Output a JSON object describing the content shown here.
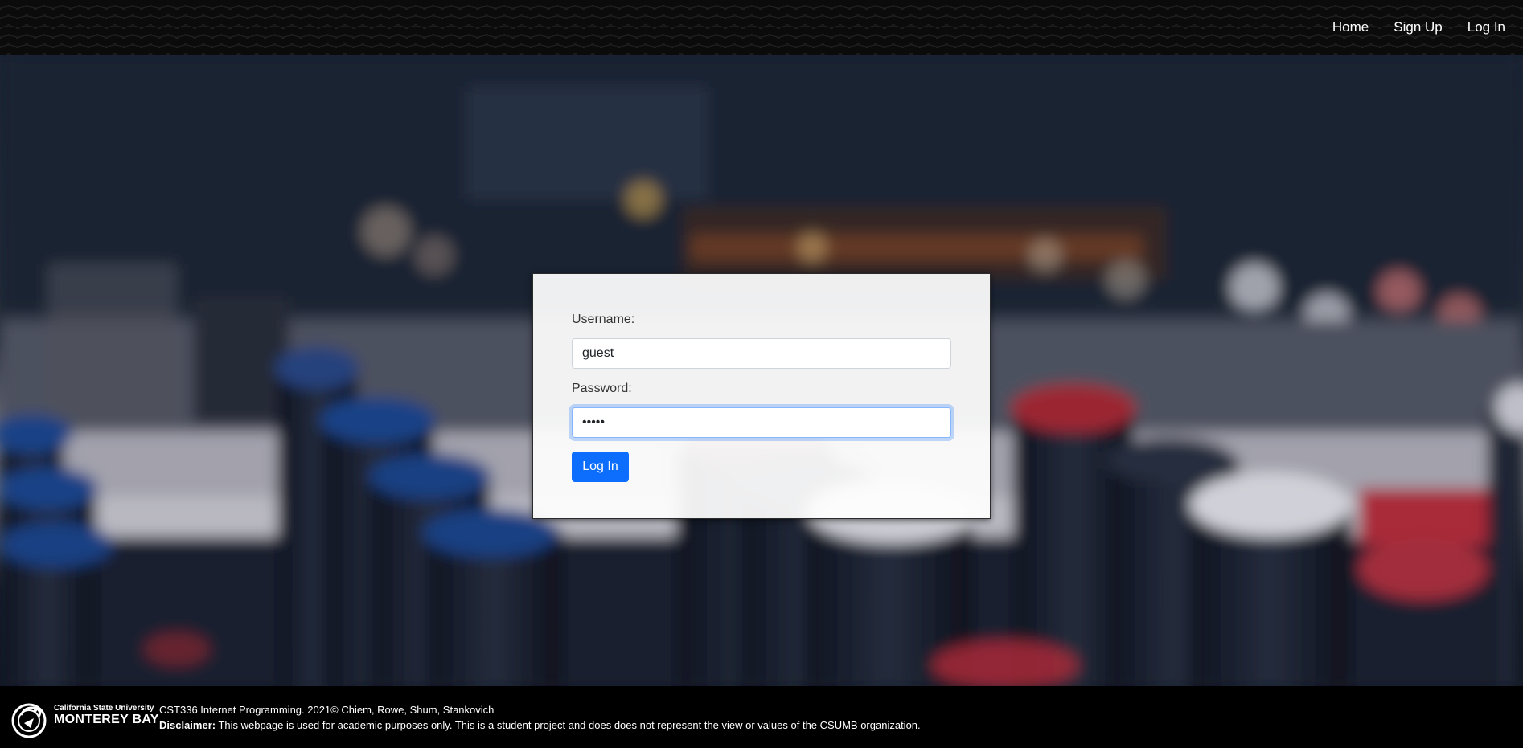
{
  "nav": {
    "home": "Home",
    "signup": "Sign Up",
    "login": "Log In"
  },
  "form": {
    "username_label": "Username:",
    "username_value": "guest",
    "password_label": "Password:",
    "password_value": "•••••",
    "submit_label": "Log In"
  },
  "footer": {
    "logo_line1": "California State University",
    "logo_line2": "MONTEREY BAY",
    "course_line": "CST336 Internet Programming. 2021© Chiem, Rowe, Shum, Stankovich",
    "disclaimer_label": "Disclaimer:",
    "disclaimer_text": " This webpage is used for academic purposes only. This is a student project and does does not represent the view or values of the CSUMB organization."
  },
  "colors": {
    "primary": "#0d6efd",
    "header_bg": "#0b0b0b",
    "footer_bg": "#000000"
  },
  "icons": {
    "logo": "csumb-otter-logo-icon"
  }
}
